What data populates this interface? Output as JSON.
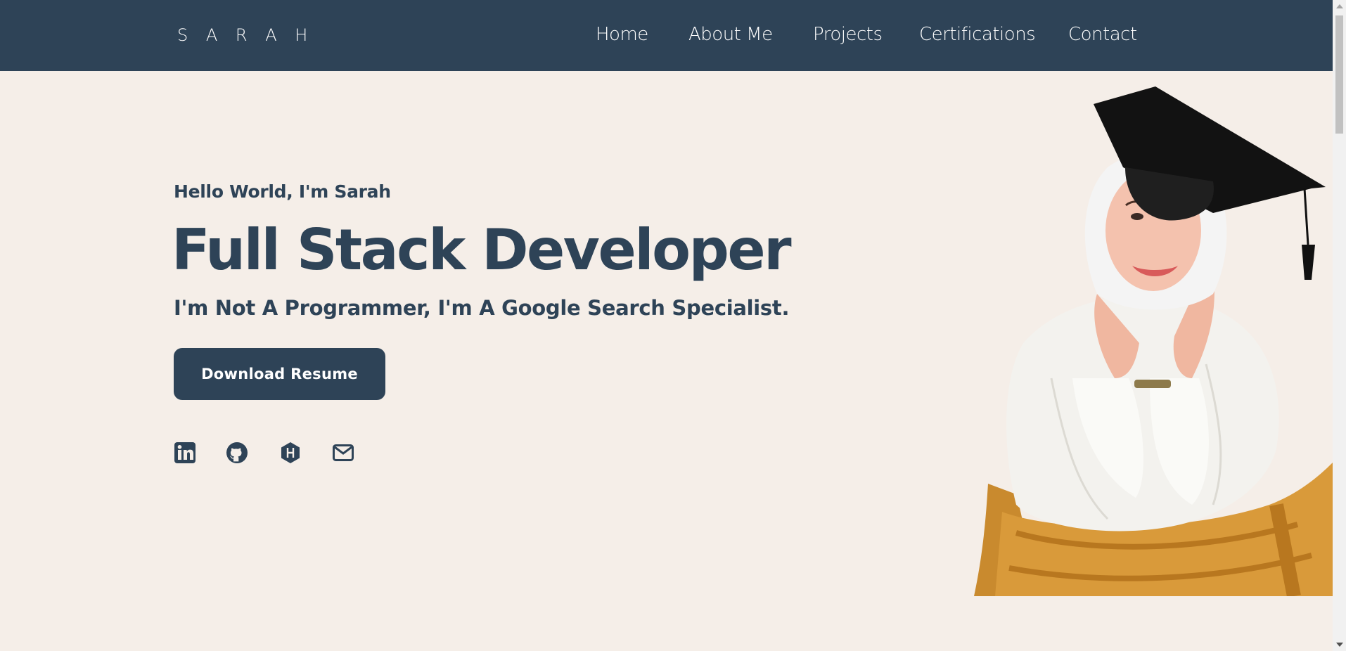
{
  "nav": {
    "brand": "S A R A H",
    "links": [
      "Home",
      "About Me",
      "Projects",
      "Certifications",
      "Contact"
    ]
  },
  "hero": {
    "greeting": "Hello World, I'm Sarah",
    "headline": "Full Stack Developer",
    "tagline": "I'm Not A Programmer, I'm A Google Search Specialist.",
    "button_label": "Download Resume"
  },
  "socials": [
    "linkedin-icon",
    "github-icon",
    "hashnode-icon",
    "email-icon"
  ],
  "colors": {
    "navbar": "#2e4357",
    "background": "#f5eee8",
    "accent": "#2e4357",
    "text_light": "#ffffff"
  }
}
